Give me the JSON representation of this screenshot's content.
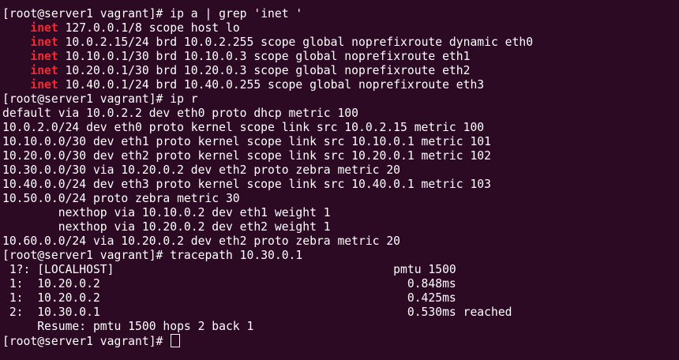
{
  "terminal": {
    "prompt": "[root@server1 vagrant]# ",
    "cmd1": "ip a | grep 'inet '",
    "inet_keyword": "inet",
    "inet1": " 127.0.0.1/8 scope host lo",
    "inet2": " 10.0.2.15/24 brd 10.0.2.255 scope global noprefixroute dynamic eth0",
    "inet3": " 10.10.0.1/30 brd 10.10.0.3 scope global noprefixroute eth1",
    "inet4": " 10.20.0.1/30 brd 10.20.0.3 scope global noprefixroute eth2",
    "inet5": " 10.40.0.1/24 brd 10.40.0.255 scope global noprefixroute eth3",
    "cmd2": "ip r",
    "route1": "default via 10.0.2.2 dev eth0 proto dhcp metric 100",
    "route2": "10.0.2.0/24 dev eth0 proto kernel scope link src 10.0.2.15 metric 100",
    "route3": "10.10.0.0/30 dev eth1 proto kernel scope link src 10.10.0.1 metric 101",
    "route4": "10.20.0.0/30 dev eth2 proto kernel scope link src 10.20.0.1 metric 102",
    "route5": "10.30.0.0/30 via 10.20.0.2 dev eth2 proto zebra metric 20",
    "route6": "10.40.0.0/24 dev eth3 proto kernel scope link src 10.40.0.1 metric 103",
    "route7": "10.50.0.0/24 proto zebra metric 30",
    "nexthop1": "        nexthop via 10.10.0.2 dev eth1 weight 1",
    "nexthop2": "        nexthop via 10.20.0.2 dev eth2 weight 1",
    "route8": "10.60.0.0/24 via 10.20.0.2 dev eth2 proto zebra metric 20",
    "cmd3": "tracepath 10.30.0.1",
    "trace1": " 1?: [LOCALHOST]                                        pmtu 1500",
    "trace2": " 1:  10.20.0.2                                            0.848ms",
    "trace3": " 1:  10.20.0.2                                            0.425ms",
    "trace4": " 2:  10.30.0.1                                            0.530ms reached",
    "trace5": "     Resume: pmtu 1500 hops 2 back 1"
  }
}
